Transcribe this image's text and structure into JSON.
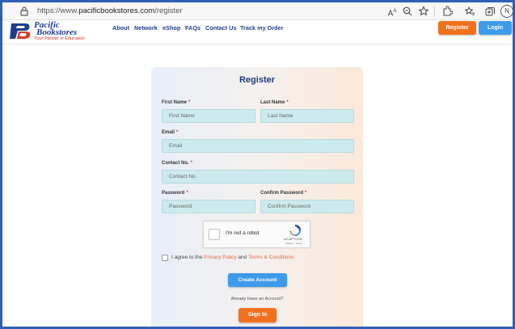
{
  "browser": {
    "url_prefix": "https://www.",
    "url_host": "pacificbookstores.com",
    "url_path": "/register",
    "profile_initial": "N",
    "icons": [
      "lock-icon",
      "read-aloud-icon",
      "zoom-icon",
      "favorite-add-icon",
      "extensions-icon",
      "favorites-icon",
      "collections-icon"
    ]
  },
  "header": {
    "logo_line1": "Pacific",
    "logo_line2": "Bookstores",
    "logo_tagline": "Your Partner in Education",
    "nav": [
      "About",
      "Network",
      "eShop",
      "FAQs",
      "Contact Us",
      "Track my Order"
    ],
    "register_label": "Register",
    "login_label": "Login"
  },
  "form": {
    "title": "Register",
    "first_name": {
      "label": "First Name",
      "placeholder": "First Name"
    },
    "last_name": {
      "label": "Last Name",
      "placeholder": "Last Name"
    },
    "email": {
      "label": "Email",
      "placeholder": "Email"
    },
    "contact": {
      "label": "Contact No.",
      "placeholder": "Contact No."
    },
    "password": {
      "label": "Password",
      "placeholder": "Password"
    },
    "confirm_password": {
      "label": "Confirm Password",
      "placeholder": "Confirm Password"
    },
    "required_mark": "*",
    "captcha": {
      "label": "I'm not a robot",
      "brand": "reCAPTCHA",
      "links": "Privacy - Terms"
    },
    "agree": {
      "prefix": "I agree to the ",
      "privacy": "Privacy Policy",
      "and": " and ",
      "terms": "Terms & Conditions"
    },
    "create_label": "Create Account",
    "already_text": "Already Have an Account?",
    "signin_label": "Sign In"
  },
  "colors": {
    "brand_blue": "#1f3e8c",
    "accent_orange": "#f2711c",
    "button_blue": "#3d9be9",
    "input_fill": "#cdebef",
    "frame": "#2f5fb8"
  }
}
